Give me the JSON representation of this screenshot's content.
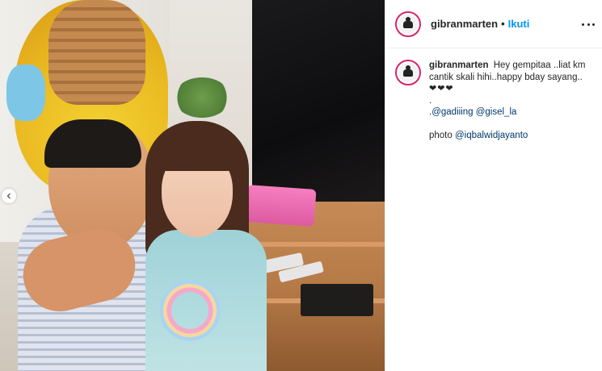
{
  "post": {
    "photo_alt": "Photo of a man pointing and a young girl",
    "carousel_prev_icon": "chevron-left-icon"
  },
  "header": {
    "username": "gibranmarten",
    "separator": "•",
    "follow_label": "Ikuti",
    "more_icon": "more-options-icon"
  },
  "comment": {
    "username": "gibranmarten",
    "caption_text": "Hey gempitaa ..liat km cantik skali hihi..happy bday sayang..",
    "hearts": "❤❤❤",
    "dot_line": ".",
    "mention_prefix": ".",
    "mention_1": "@gadiiing",
    "mention_2": "@gisel_la",
    "photo_label": "photo",
    "photo_credit": "@iqbalwidjayanto"
  },
  "colors": {
    "accent_link": "#0095f6",
    "mention": "#00376b",
    "story_ring": "#d6256a"
  }
}
